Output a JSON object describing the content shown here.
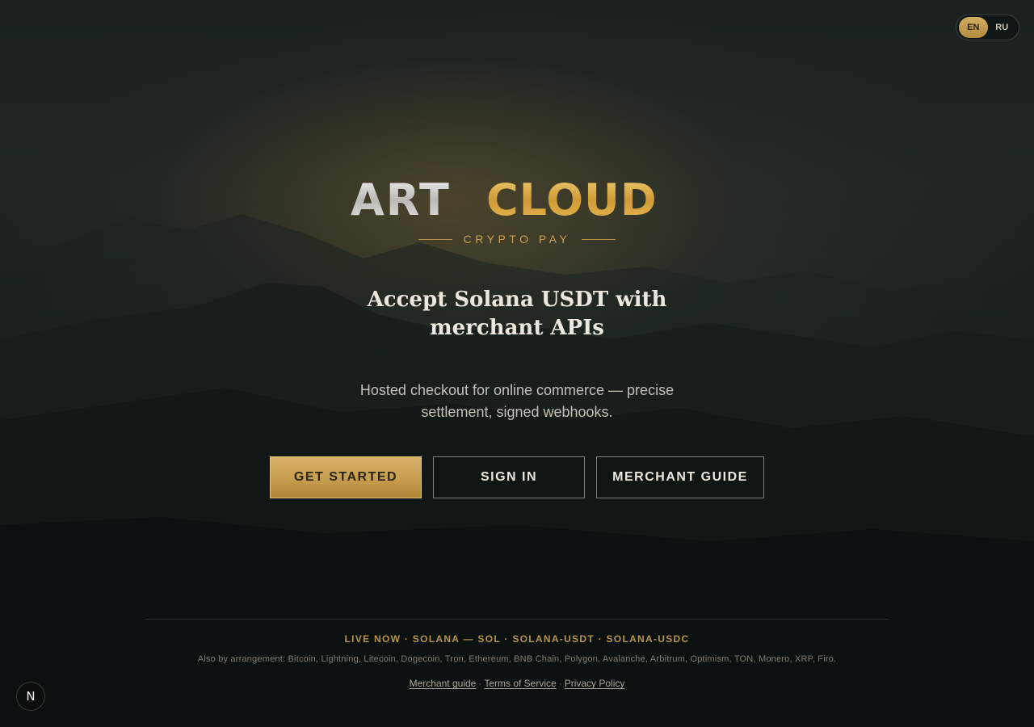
{
  "lang": {
    "en": "EN",
    "ru": "RU",
    "active": "EN"
  },
  "brand": {
    "logo_left": "ART",
    "logo_right": "CLOUD",
    "tagline": "CRYPTO PAY",
    "accent": "#c9a055"
  },
  "hero": {
    "headline": "Accept Solana USDT with merchant APIs",
    "subhead": "Hosted checkout for online commerce — precise settlement, signed webhooks."
  },
  "cta": {
    "get_started": "GET STARTED",
    "sign_in": "SIGN IN",
    "merchant_guide": "MERCHANT GUIDE"
  },
  "footer": {
    "live": "LIVE NOW · SOLANA — SOL · SOLANA-USDT · SOLANA-USDC",
    "also": "Also by arrangement: Bitcoin, Lightning, Litecoin, Dogecoin, Tron, Ethereum, BNB Chain, Polygon, Avalanche, Arbitrum, Optimism, TON, Monero, XRP, Firo.",
    "links": {
      "merchant_guide": "Merchant guide",
      "terms": "Terms of Service",
      "privacy": "Privacy Policy",
      "separator": "·"
    }
  },
  "badge": {
    "label": "N"
  }
}
